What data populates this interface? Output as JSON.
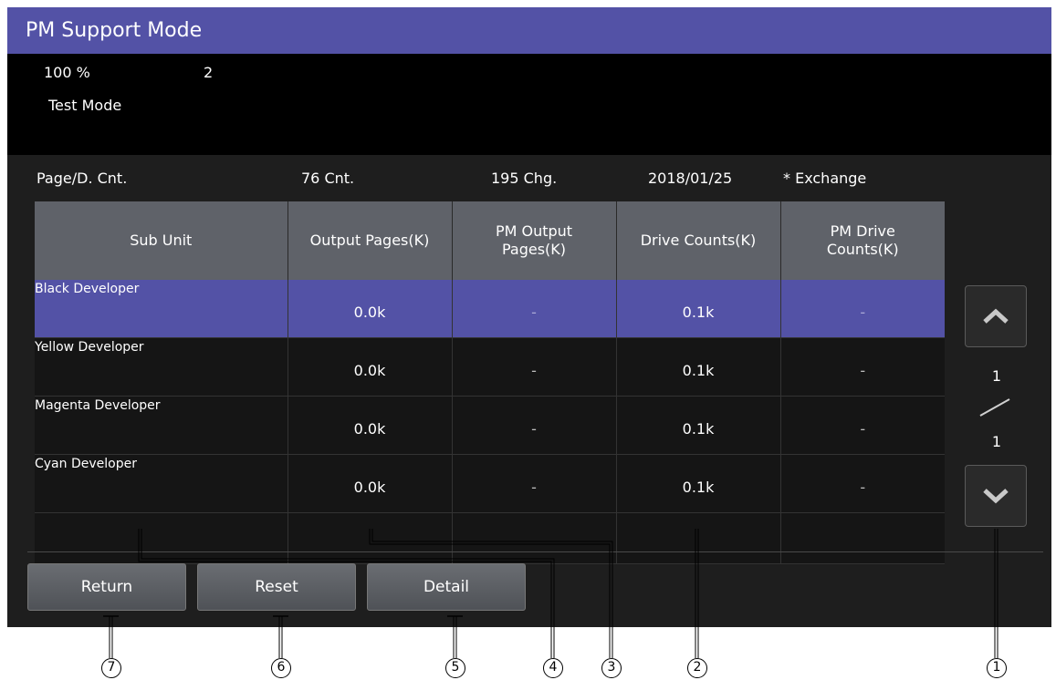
{
  "title": "PM Support Mode",
  "status": {
    "zoom": "100 %",
    "copies": "2",
    "mode": "Test Mode"
  },
  "info": {
    "label": "Page/D. Cnt.",
    "count": "76 Cnt.",
    "changes": "195 Chg.",
    "date": "2018/01/25",
    "note": "* Exchange"
  },
  "table": {
    "headers": [
      "Sub Unit",
      "Output Pages(K)",
      "PM Output Pages(K)",
      "Drive Counts(K)",
      "PM Drive Counts(K)"
    ],
    "rows": [
      {
        "name": "Black Developer",
        "output": "0.0k",
        "pm_output": "-",
        "drive": "0.1k",
        "pm_drive": "-",
        "selected": true
      },
      {
        "name": "Yellow Developer",
        "output": "0.0k",
        "pm_output": "-",
        "drive": "0.1k",
        "pm_drive": "-"
      },
      {
        "name": "Magenta Developer",
        "output": "0.0k",
        "pm_output": "-",
        "drive": "0.1k",
        "pm_drive": "-"
      },
      {
        "name": "Cyan Developer",
        "output": "0.0k",
        "pm_output": "-",
        "drive": "0.1k",
        "pm_drive": "-"
      }
    ]
  },
  "pager": {
    "current": "1",
    "total": "1",
    "up_icon": "chevron-up-icon",
    "down_icon": "chevron-down-icon"
  },
  "buttons": {
    "return": "Return",
    "reset": "Reset",
    "detail": "Detail"
  },
  "callouts": [
    "1",
    "2",
    "3",
    "4",
    "5",
    "6",
    "7"
  ],
  "colors": {
    "title_bar": "#5352a6",
    "selected_row": "#5352a6",
    "header": "#5f6269"
  }
}
